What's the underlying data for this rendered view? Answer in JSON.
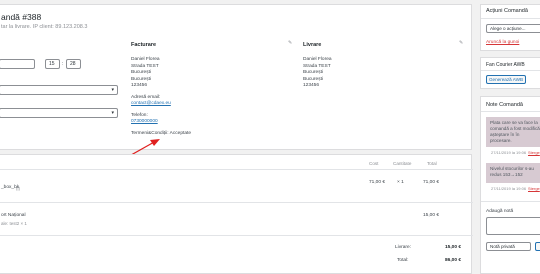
{
  "order": {
    "title": "andă #388",
    "subtitle": "tar la livrare. IP client: 89.123.208.3"
  },
  "general": {
    "hour": "15",
    "minute": "28"
  },
  "billing": {
    "heading": "Facturare",
    "lines": [
      "Daniel Florea",
      "Strada TEST",
      "București",
      "București",
      "123456"
    ],
    "email_label": "Adresă email:",
    "email": "contact@cdaex.eu",
    "phone_label": "Telefon:",
    "phone": "0730000000",
    "terms": "Termeni&Condiții: Acceptate"
  },
  "shipping": {
    "heading": "Livrare",
    "lines": [
      "Daniel Florea",
      "Strada TEST",
      "București",
      "București",
      "123456"
    ]
  },
  "items": {
    "col_cost": "Cost",
    "col_qty": "Cantitate",
    "col_total": "Total",
    "row_name": "_box_bk",
    "row_meta": "(i)",
    "row_cost": "71,00 €",
    "row_qty": "× 1",
    "row_total": "71,00 €",
    "ship_name": "ort Național",
    "ship_meta": "ale: test2 × 1",
    "ship_total": "15,00 €"
  },
  "totals": {
    "shipping_label": "Livrare:",
    "shipping_value": "15,00 €",
    "total_label": "Total:",
    "total_value": "86,00 €"
  },
  "actions": {
    "title": "Acțiuni Comandă",
    "select_placeholder": "Alege o acțiune...",
    "trash_link": "Aruncă la gunoi"
  },
  "fancourier": {
    "title": "Fan Courier AWB",
    "button": "Generează AWB"
  },
  "notes": {
    "title": "Note Comandă",
    "note1_text": "Plata care se va face la comandă a fost modifică așteptare în în procesare.",
    "note1_meta": "27/11/2019 la 19:06",
    "note1_delete": "Șterge",
    "note2_text": "Nivelul stocurilor s-au redus 153→152",
    "note2_meta": "27/11/2019 la 19:06",
    "note2_delete": "Șterge",
    "add_label": "Adaugă notă",
    "type_value": "Notă privată"
  },
  "colors": {
    "accent": "#2271b1",
    "note_bg": "#d7cad2",
    "arrow": "#e0201f",
    "danger": "#d63638"
  }
}
